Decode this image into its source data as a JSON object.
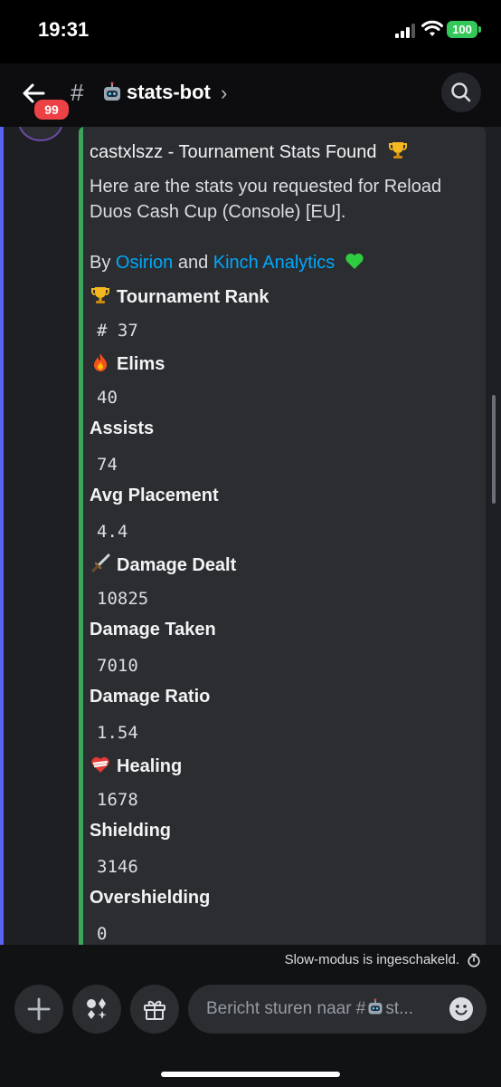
{
  "status_bar": {
    "time": "19:31",
    "battery": "100"
  },
  "header": {
    "unread_badge": "99",
    "channel_prefix": "#",
    "channel_name": "stats-bot",
    "chevron": "›",
    "icons": {
      "back": "arrow-left-icon",
      "channel_emoji": "robot-emoji-icon",
      "search": "search-icon"
    }
  },
  "embed": {
    "accent_color": "#3ba55c",
    "title": "castxlszz - Tournament Stats Found",
    "description": "Here are the stats you requested for Reload Duos Cash Cup (Console) [EU].",
    "by_prefix": "By",
    "credit_1": "Osirion",
    "and_text": "and",
    "credit_2": "Kinch Analytics",
    "fields": [
      {
        "name": "Tournament Rank",
        "value": "# 37",
        "icon": "trophy-emoji"
      },
      {
        "name": "Elims",
        "value": "40",
        "icon": "fire-emoji"
      },
      {
        "name": "Assists",
        "value": "74"
      },
      {
        "name": "Avg Placement",
        "value": "4.4"
      },
      {
        "name": "Damage Dealt",
        "value": "10825",
        "icon": "dagger-emoji"
      },
      {
        "name": "Damage Taken",
        "value": "7010"
      },
      {
        "name": "Damage Ratio",
        "value": "1.54"
      },
      {
        "name": "Healing",
        "value": "1678",
        "icon": "bandaged-heart-emoji"
      },
      {
        "name": "Shielding",
        "value": "3146"
      },
      {
        "name": "Overshielding",
        "value": "0"
      }
    ]
  },
  "slow_mode_text": "Slow-modus is ingeschakeld.",
  "composer": {
    "placeholder_prefix": "Bericht sturen naar #",
    "placeholder_suffix": "st...",
    "icons": [
      "plus-icon",
      "apps-icon",
      "gift-icon",
      "emoji-icon"
    ]
  },
  "colors": {
    "link": "#00a8fc",
    "badge": "#ed4245",
    "battery": "#34c759",
    "channel_strip": "#5865f2"
  }
}
